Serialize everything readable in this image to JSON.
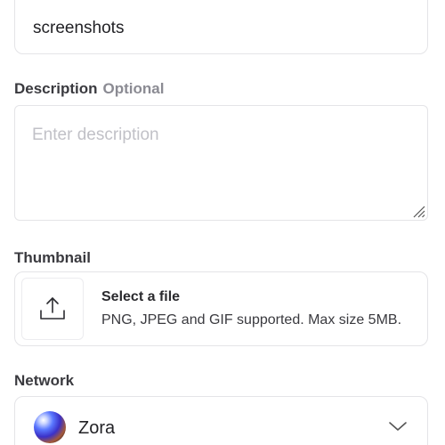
{
  "name_field": {
    "value": "screenshots"
  },
  "description": {
    "label": "Description",
    "optional_tag": "Optional",
    "placeholder": "Enter description"
  },
  "thumbnail": {
    "label": "Thumbnail",
    "upload_icon": "upload-icon",
    "title": "Select a file",
    "subtitle": "PNG, JPEG and GIF supported. Max size 5MB."
  },
  "network": {
    "label": "Network",
    "selected": "Zora",
    "icon": "zora-orb-icon",
    "dropdown_icon": "chevron-down-icon"
  }
}
